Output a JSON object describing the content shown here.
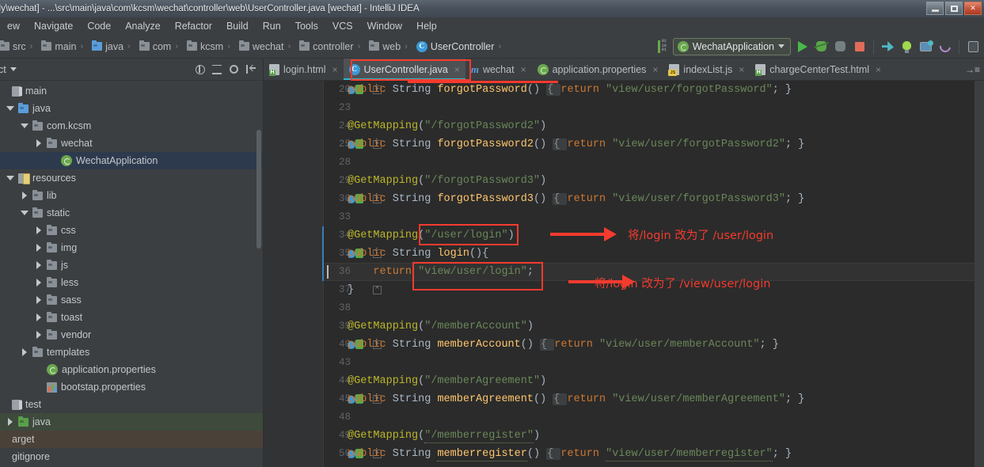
{
  "window": {
    "title": "ily\\wechat] - ...\\src\\main\\java\\com\\kcsm\\wechat\\controller\\web\\UserController.java [wechat] - IntelliJ IDEA",
    "minimize_label": "Minimize",
    "maximize_label": "Maximize",
    "close_label": "Close"
  },
  "menubar": {
    "items": [
      {
        "label": "ew"
      },
      {
        "label": "Navigate"
      },
      {
        "label": "Code"
      },
      {
        "label": "Analyze"
      },
      {
        "label": "Refactor"
      },
      {
        "label": "Build"
      },
      {
        "label": "Run"
      },
      {
        "label": "Tools"
      },
      {
        "label": "VCS"
      },
      {
        "label": "Window"
      },
      {
        "label": "Help"
      }
    ]
  },
  "breadcrumb": {
    "items": [
      {
        "label": "src",
        "icon": "folder-icon"
      },
      {
        "label": "main",
        "icon": "folder-icon"
      },
      {
        "label": "java",
        "icon": "folder-blue-icon"
      },
      {
        "label": "com",
        "icon": "folder-icon"
      },
      {
        "label": "kcsm",
        "icon": "folder-icon"
      },
      {
        "label": "wechat",
        "icon": "folder-icon"
      },
      {
        "label": "controller",
        "icon": "folder-icon"
      },
      {
        "label": "web",
        "icon": "folder-icon"
      },
      {
        "label": "UserController",
        "icon": "java-class-icon"
      }
    ]
  },
  "toolbar": {
    "run_config": "WechatApplication",
    "icons": [
      {
        "name": "binary-toggle-icon"
      },
      {
        "name": "run-icon"
      },
      {
        "name": "debug-icon"
      },
      {
        "name": "coverage-icon"
      },
      {
        "name": "stop-icon"
      },
      {
        "name": "update-project-icon"
      },
      {
        "name": "commit-icon"
      },
      {
        "name": "remote-desktop-icon"
      },
      {
        "name": "revert-icon"
      },
      {
        "name": "database-icon"
      }
    ]
  },
  "sidebar": {
    "title": "ct",
    "header_icons": [
      {
        "name": "locate-target-icon"
      },
      {
        "name": "collapse-all-icon"
      },
      {
        "name": "settings-gear-icon"
      },
      {
        "name": "hide-panel-icon"
      }
    ],
    "tree": [
      {
        "label": "main",
        "indent": 0,
        "arrow": "none",
        "icon": "module-icon",
        "state": "normal"
      },
      {
        "label": "java",
        "indent": 1,
        "arrow": "down",
        "icon": "folder-blue-icon",
        "state": "normal"
      },
      {
        "label": "com.kcsm",
        "indent": 2,
        "arrow": "down",
        "icon": "folder-icon",
        "state": "normal"
      },
      {
        "label": "wechat",
        "indent": 3,
        "arrow": "right",
        "icon": "folder-icon",
        "state": "normal"
      },
      {
        "label": "WechatApplication",
        "indent": 4,
        "arrow": "none",
        "icon": "spring-class-icon",
        "state": "selected"
      },
      {
        "label": "resources",
        "indent": 1,
        "arrow": "down",
        "icon": "resources-icon",
        "state": "normal"
      },
      {
        "label": "lib",
        "indent": 2,
        "arrow": "right",
        "icon": "folder-icon",
        "state": "normal"
      },
      {
        "label": "static",
        "indent": 2,
        "arrow": "down",
        "icon": "folder-icon",
        "state": "normal"
      },
      {
        "label": "css",
        "indent": 3,
        "arrow": "right",
        "icon": "folder-icon",
        "state": "normal"
      },
      {
        "label": "img",
        "indent": 3,
        "arrow": "right",
        "icon": "folder-icon",
        "state": "normal"
      },
      {
        "label": "js",
        "indent": 3,
        "arrow": "right",
        "icon": "folder-icon",
        "state": "normal"
      },
      {
        "label": "less",
        "indent": 3,
        "arrow": "right",
        "icon": "folder-icon",
        "state": "normal"
      },
      {
        "label": "sass",
        "indent": 3,
        "arrow": "right",
        "icon": "folder-icon",
        "state": "normal"
      },
      {
        "label": "toast",
        "indent": 3,
        "arrow": "right",
        "icon": "folder-icon",
        "state": "normal"
      },
      {
        "label": "vendor",
        "indent": 3,
        "arrow": "right",
        "icon": "folder-icon",
        "state": "normal"
      },
      {
        "label": "templates",
        "indent": 2,
        "arrow": "right",
        "icon": "folder-icon",
        "state": "normal"
      },
      {
        "label": "application.properties",
        "indent": 3,
        "arrow": "none",
        "icon": "spring-props-icon",
        "state": "normal"
      },
      {
        "label": "bootstap.properties",
        "indent": 3,
        "arrow": "none",
        "icon": "properties-icon",
        "state": "normal"
      },
      {
        "label": "test",
        "indent": 0,
        "arrow": "none",
        "icon": "module-icon",
        "state": "normal"
      },
      {
        "label": "java",
        "indent": 1,
        "arrow": "right",
        "icon": "folder-green-icon",
        "state": "green"
      },
      {
        "label": "arget",
        "indent": 0,
        "arrow": "none",
        "icon": "none",
        "state": "brown"
      },
      {
        "label": "gitignore",
        "indent": 0,
        "arrow": "none",
        "icon": "none",
        "state": "normal"
      }
    ]
  },
  "tabs": [
    {
      "label": "login.html",
      "icon": "html-file-icon",
      "active": false,
      "close": "×"
    },
    {
      "label": "UserController.java",
      "icon": "java-class-icon",
      "active": true,
      "close": "×"
    },
    {
      "label": "wechat",
      "icon": "maven-pom-icon",
      "active": false,
      "close": "×"
    },
    {
      "label": "application.properties",
      "icon": "spring-props-icon",
      "active": false,
      "close": "×"
    },
    {
      "label": "indexList.js",
      "icon": "js-file-icon",
      "active": false,
      "close": "×"
    },
    {
      "label": "chargeCenterTest.html",
      "icon": "html-file-icon",
      "active": false,
      "close": "×"
    }
  ],
  "editor": {
    "lines": [
      {
        "num": "20",
        "gutter": "spring-bean",
        "fold": "+",
        "segments": [
          {
            "t": "public ",
            "c": "k"
          },
          {
            "t": "String ",
            "c": "t"
          },
          {
            "t": "forgotPassword",
            "c": "m"
          },
          {
            "t": "() ",
            "c": "p"
          },
          {
            "t": "{ ",
            "c": "fold-inline"
          },
          {
            "t": "return ",
            "c": "k"
          },
          {
            "t": "\"view/user/forgotPassword\"",
            "c": "s"
          },
          {
            "t": "; }",
            "c": "p"
          }
        ]
      },
      {
        "num": "23",
        "gutter": "",
        "fold": "",
        "segments": []
      },
      {
        "num": "24",
        "gutter": "",
        "fold": "",
        "segments": [
          {
            "t": "@GetMapping",
            "c": "an"
          },
          {
            "t": "(",
            "c": "p"
          },
          {
            "t": "\"/forgotPassword2\"",
            "c": "s"
          },
          {
            "t": ")",
            "c": "p"
          }
        ]
      },
      {
        "num": "25",
        "gutter": "spring-bean",
        "fold": "+",
        "segments": [
          {
            "t": "public ",
            "c": "k"
          },
          {
            "t": "String ",
            "c": "t"
          },
          {
            "t": "forgotPassword2",
            "c": "m"
          },
          {
            "t": "() ",
            "c": "p"
          },
          {
            "t": "{ ",
            "c": "fold-inline"
          },
          {
            "t": "return ",
            "c": "k"
          },
          {
            "t": "\"view/user/forgotPassword2\"",
            "c": "s"
          },
          {
            "t": "; }",
            "c": "p"
          }
        ]
      },
      {
        "num": "28",
        "gutter": "",
        "fold": "",
        "segments": []
      },
      {
        "num": "29",
        "gutter": "",
        "fold": "",
        "segments": [
          {
            "t": "@GetMapping",
            "c": "an"
          },
          {
            "t": "(",
            "c": "p"
          },
          {
            "t": "\"/forgotPassword3\"",
            "c": "s"
          },
          {
            "t": ")",
            "c": "p"
          }
        ]
      },
      {
        "num": "30",
        "gutter": "spring-bean",
        "fold": "+",
        "segments": [
          {
            "t": "public ",
            "c": "k"
          },
          {
            "t": "String ",
            "c": "t"
          },
          {
            "t": "forgotPassword3",
            "c": "m"
          },
          {
            "t": "() ",
            "c": "p"
          },
          {
            "t": "{ ",
            "c": "fold-inline"
          },
          {
            "t": "return ",
            "c": "k"
          },
          {
            "t": "\"view/user/forgotPassword3\"",
            "c": "s"
          },
          {
            "t": "; }",
            "c": "p"
          }
        ]
      },
      {
        "num": "33",
        "gutter": "",
        "fold": "",
        "segments": []
      },
      {
        "num": "34",
        "gutter": "",
        "fold": "",
        "segments": [
          {
            "t": "@GetMapping",
            "c": "an"
          },
          {
            "t": "(",
            "c": "p"
          },
          {
            "t": "\"/user/login\"",
            "c": "s"
          },
          {
            "t": ")",
            "c": "p"
          }
        ]
      },
      {
        "num": "35",
        "gutter": "spring-bean",
        "fold": "-",
        "segments": [
          {
            "t": "public ",
            "c": "k"
          },
          {
            "t": "String ",
            "c": "t"
          },
          {
            "t": "login",
            "c": "m"
          },
          {
            "t": "(){",
            "c": "p"
          }
        ]
      },
      {
        "num": "36",
        "gutter": "",
        "fold": "",
        "caret": true,
        "segments": [
          {
            "t": "    return ",
            "c": "k"
          },
          {
            "t": "\"view/user/login\"",
            "c": "s"
          },
          {
            "t": ";",
            "c": "p"
          }
        ]
      },
      {
        "num": "37",
        "gutter": "",
        "fold": "⌃",
        "segments": [
          {
            "t": "}",
            "c": "p"
          }
        ]
      },
      {
        "num": "38",
        "gutter": "",
        "fold": "",
        "segments": []
      },
      {
        "num": "39",
        "gutter": "",
        "fold": "",
        "segments": [
          {
            "t": "@GetMapping",
            "c": "an"
          },
          {
            "t": "(",
            "c": "p"
          },
          {
            "t": "\"/memberAccount\"",
            "c": "s"
          },
          {
            "t": ")",
            "c": "p"
          }
        ]
      },
      {
        "num": "40",
        "gutter": "spring-bean",
        "fold": "+",
        "segments": [
          {
            "t": "public ",
            "c": "k"
          },
          {
            "t": "String ",
            "c": "t"
          },
          {
            "t": "memberAccount",
            "c": "m"
          },
          {
            "t": "() ",
            "c": "p"
          },
          {
            "t": "{ ",
            "c": "fold-inline"
          },
          {
            "t": "return ",
            "c": "k"
          },
          {
            "t": "\"view/user/memberAccount\"",
            "c": "s"
          },
          {
            "t": "; }",
            "c": "p"
          }
        ]
      },
      {
        "num": "43",
        "gutter": "",
        "fold": "",
        "segments": []
      },
      {
        "num": "44",
        "gutter": "",
        "fold": "",
        "segments": [
          {
            "t": "@GetMapping",
            "c": "an"
          },
          {
            "t": "(",
            "c": "p"
          },
          {
            "t": "\"/memberAgreement\"",
            "c": "s"
          },
          {
            "t": ")",
            "c": "p"
          }
        ]
      },
      {
        "num": "45",
        "gutter": "spring-bean",
        "fold": "+",
        "segments": [
          {
            "t": "public ",
            "c": "k"
          },
          {
            "t": "String ",
            "c": "t"
          },
          {
            "t": "memberAgreement",
            "c": "m"
          },
          {
            "t": "() ",
            "c": "p"
          },
          {
            "t": "{ ",
            "c": "fold-inline"
          },
          {
            "t": "return ",
            "c": "k"
          },
          {
            "t": "\"view/user/memberAgreement\"",
            "c": "s"
          },
          {
            "t": "; }",
            "c": "p"
          }
        ]
      },
      {
        "num": "48",
        "gutter": "",
        "fold": "",
        "segments": []
      },
      {
        "num": "49",
        "gutter": "",
        "fold": "",
        "segments": [
          {
            "t": "@GetMapping",
            "c": "an"
          },
          {
            "t": "(",
            "c": "p"
          },
          {
            "t": "\"/memberregister\"",
            "c": "s wavy"
          },
          {
            "t": ")",
            "c": "p"
          }
        ]
      },
      {
        "num": "50",
        "gutter": "spring-bean",
        "fold": "+",
        "segments": [
          {
            "t": "public ",
            "c": "k"
          },
          {
            "t": "String ",
            "c": "t"
          },
          {
            "t": "memberregister",
            "c": "m wavy"
          },
          {
            "t": "() ",
            "c": "p"
          },
          {
            "t": "{ ",
            "c": "fold-inline"
          },
          {
            "t": "return ",
            "c": "k"
          },
          {
            "t": "\"view/user/memberregister\"",
            "c": "s wavy"
          },
          {
            "t": "; }",
            "c": "p"
          }
        ]
      }
    ]
  },
  "annotations": [
    {
      "name": "annotation-user-login",
      "text": "将/login 改为了  /user/login"
    },
    {
      "name": "annotation-view-user-login",
      "text": "将/login 改为了  /view/user/login"
    }
  ],
  "colors": {
    "accent_red": "#f43b2e",
    "tab_underline": "#2fb7c9",
    "editor_bg": "#2b2b2b",
    "panel_bg": "#3c3f41",
    "selection_blue": "#2d3a4d",
    "string_green": "#6a8759",
    "keyword_orange": "#cc7832",
    "annotation_yellow": "#bbb529",
    "method_yellow": "#ffc66d"
  }
}
